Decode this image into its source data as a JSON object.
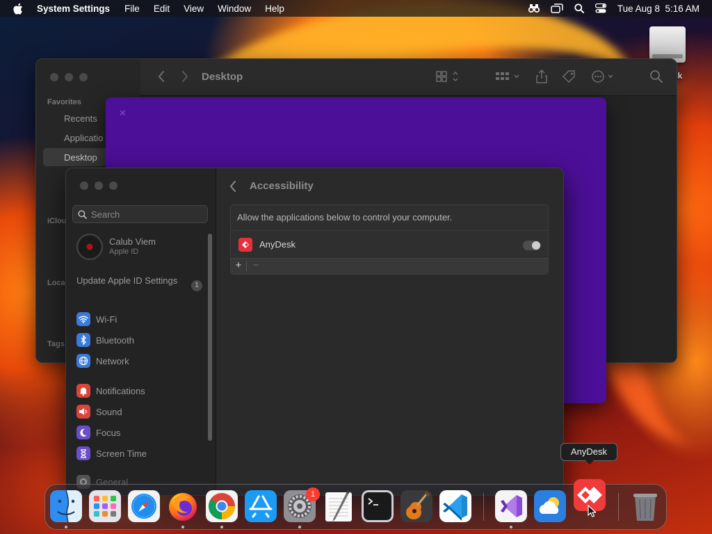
{
  "menubar": {
    "app_name": "System Settings",
    "menus": [
      "File",
      "Edit",
      "View",
      "Window",
      "Help"
    ],
    "clock": "Tue Aug 8  5:16 AM",
    "status_icons": [
      "finder-duo-icon",
      "screen-mirroring-icon",
      "spotlight-search-icon",
      "control-center-icon"
    ]
  },
  "desktop": {
    "drive_label": "sk"
  },
  "finder": {
    "title": "Desktop",
    "favorites_header": "Favorites",
    "items": [
      "Recents",
      "Applicatio",
      "Desktop"
    ],
    "icloud_header": "iClou",
    "locations_header": "Loca",
    "tags_header": "Tags"
  },
  "settings": {
    "search_placeholder": "Search",
    "account": {
      "name": "Calub Viem",
      "subtitle": "Apple ID"
    },
    "update": {
      "label": "Update Apple ID Settings",
      "badge": "1"
    },
    "sidebar_items": [
      {
        "label": "Wi-Fi",
        "icon": "wifi-icon",
        "color": "#3a7ad9"
      },
      {
        "label": "Bluetooth",
        "icon": "bluetooth-icon",
        "color": "#3a7ad9"
      },
      {
        "label": "Network",
        "icon": "network-icon",
        "color": "#3a7ad9"
      },
      {
        "label": "Notifications",
        "icon": "notifications-icon",
        "color": "#d9453a"
      },
      {
        "label": "Sound",
        "icon": "sound-icon",
        "color": "#d9453a"
      },
      {
        "label": "Focus",
        "icon": "focus-icon",
        "color": "#6a4fc9"
      },
      {
        "label": "Screen Time",
        "icon": "screen-time-icon",
        "color": "#6a4fc9"
      },
      {
        "label": "General",
        "icon": "general-icon",
        "color": "#7a7a7a"
      }
    ],
    "page_title": "Accessibility",
    "panel": {
      "description": "Allow the applications below to control your computer.",
      "apps": [
        {
          "name": "AnyDesk",
          "enabled": true
        }
      ],
      "add_label": "+",
      "remove_label": "−"
    }
  },
  "dock": {
    "apps": [
      "Finder",
      "Launchpad",
      "Safari",
      "Firefox",
      "Google Chrome",
      "App Store",
      "System Settings",
      "TextEdit",
      "Terminal",
      "GarageBand",
      "Visual Studio Code",
      "Visual Studio",
      "Weather",
      "AnyDesk",
      "Trash"
    ],
    "settings_badge": "1",
    "tooltip": "AnyDesk"
  }
}
